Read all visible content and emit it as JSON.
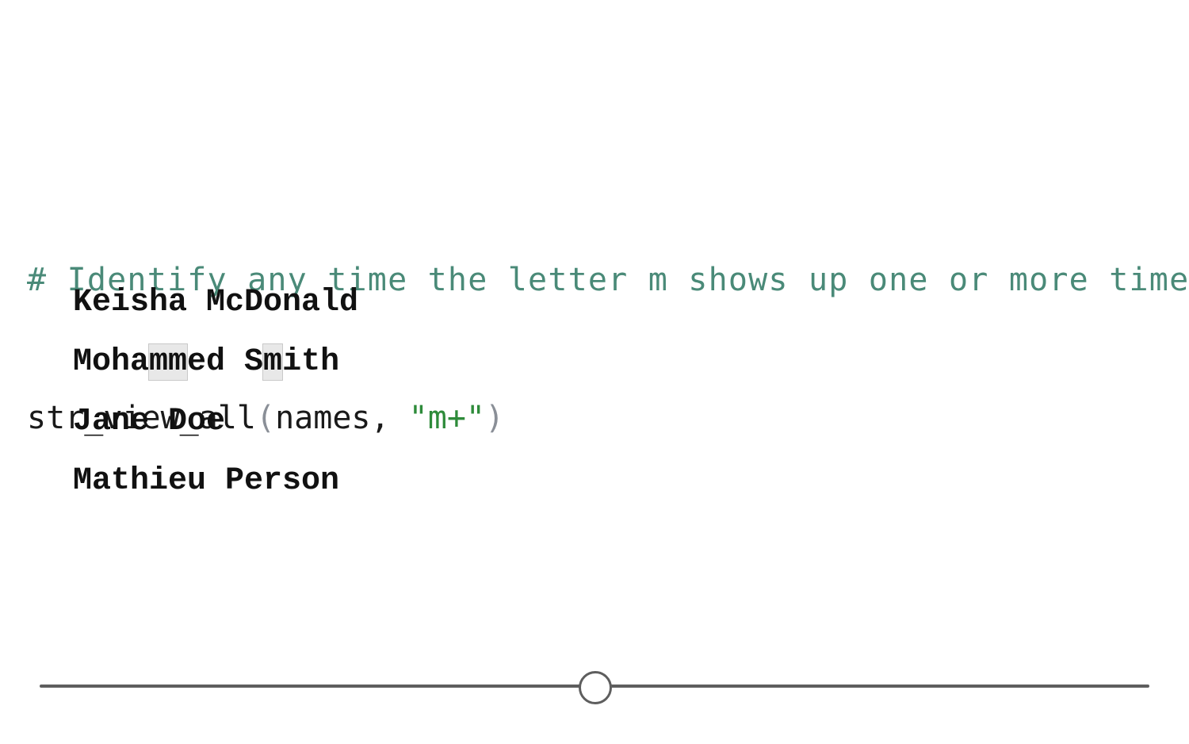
{
  "code": {
    "comment": "# Identify any time the letter m shows up one or more times",
    "call_function": "str_view_all",
    "open_paren": "(",
    "call_args": "names, ",
    "string_literal": "\"m+\"",
    "close_paren": ")"
  },
  "output": {
    "rows": [
      {
        "segments": [
          {
            "text": "Keisha McDonald",
            "match": false
          }
        ]
      },
      {
        "segments": [
          {
            "text": "Moha",
            "match": false
          },
          {
            "text": "mm",
            "match": true
          },
          {
            "text": "ed S",
            "match": false
          },
          {
            "text": "m",
            "match": true
          },
          {
            "text": "ith",
            "match": false
          }
        ]
      },
      {
        "segments": [
          {
            "text": "Jane Doe",
            "match": false
          }
        ]
      },
      {
        "segments": [
          {
            "text": "Mathieu Person",
            "match": false
          }
        ]
      }
    ]
  },
  "slider": {
    "value": 0.5
  },
  "colors": {
    "comment": "#4a8a78",
    "string": "#2e8b3a",
    "match_highlight": "#e8e8e8",
    "slider": "#5e5e5e"
  }
}
